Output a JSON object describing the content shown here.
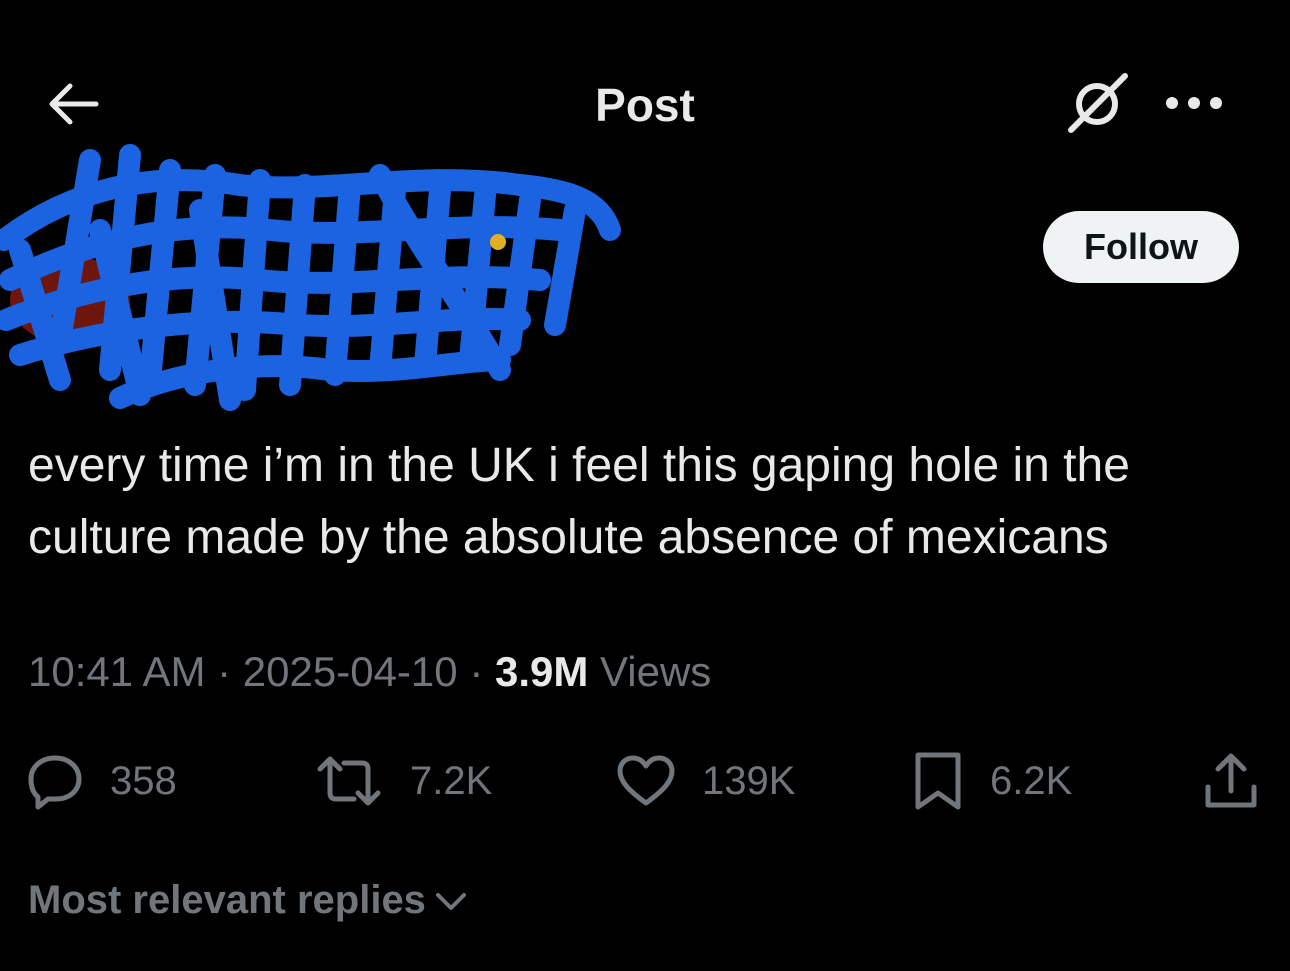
{
  "header": {
    "title": "Post",
    "back_icon": "arrow-left-icon",
    "grok_icon": "grok-icon",
    "more_icon": "more-horizontal-icon"
  },
  "author": {
    "redacted": true,
    "scribble_color": "#1b63e0",
    "follow_label": "Follow"
  },
  "post": {
    "text_line1": "every time i’m in the UK i feel this gaping hole in the",
    "text_line2": "culture made by the absolute absence of mexicans",
    "time": "10:41 AM",
    "date": "2025-04-10",
    "views_count": "3.9M",
    "views_label": "Views"
  },
  "actions": {
    "replies": "358",
    "reposts": "7.2K",
    "likes": "139K",
    "bookmarks": "6.2K"
  },
  "replies_sort": {
    "label": "Most relevant replies"
  },
  "colors": {
    "background": "#000000",
    "text": "#e7e9ea",
    "muted": "#71767b",
    "follow_bg": "#eff3f4"
  }
}
